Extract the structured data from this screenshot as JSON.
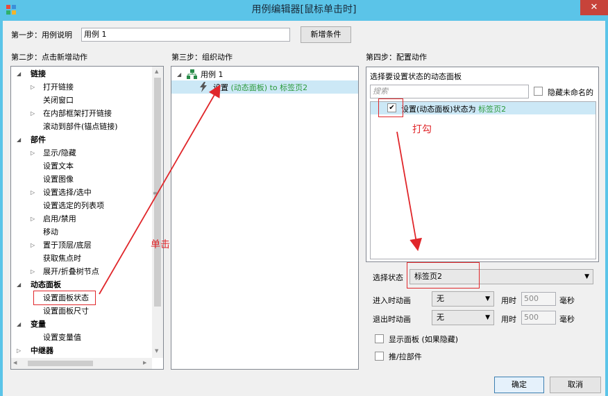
{
  "window": {
    "title": "用例编辑器[鼠标单击时]",
    "close_glyph": "✕"
  },
  "step1": {
    "label": "第一步：用例说明",
    "case_name": "用例 1",
    "add_condition_button": "新增条件"
  },
  "step2": {
    "label": "第二步：点击新增动作",
    "tree": [
      {
        "text": "链接",
        "bold": true,
        "expand": "◢"
      },
      {
        "text": "打开链接",
        "expand": "▷"
      },
      {
        "text": "关闭窗口"
      },
      {
        "text": "在内部框架打开链接",
        "expand": "▷"
      },
      {
        "text": "滚动到部件(锚点链接)"
      },
      {
        "text": "部件",
        "bold": true,
        "expand": "◢"
      },
      {
        "text": "显示/隐藏",
        "expand": "▷"
      },
      {
        "text": "设置文本"
      },
      {
        "text": "设置图像"
      },
      {
        "text": "设置选择/选中",
        "expand": "▷"
      },
      {
        "text": "设置选定的列表项"
      },
      {
        "text": "启用/禁用",
        "expand": "▷"
      },
      {
        "text": "移动"
      },
      {
        "text": "置于顶层/底层",
        "expand": "▷"
      },
      {
        "text": "获取焦点时"
      },
      {
        "text": "展开/折叠树节点",
        "expand": "▷"
      },
      {
        "text": "动态面板",
        "bold": true,
        "expand": "◢"
      },
      {
        "text": "设置面板状态",
        "highlight": true
      },
      {
        "text": "设置面板尺寸"
      },
      {
        "text": "变量",
        "bold": true,
        "expand": "◢"
      },
      {
        "text": "设置变量值"
      },
      {
        "text": "中继器",
        "bold": true,
        "expand": "▷"
      }
    ]
  },
  "step3": {
    "label": "第三步：组织动作",
    "case_label": "用例 1",
    "action_prefix": "设置",
    "action_detail": "(动态面板) to 标签页2"
  },
  "step4": {
    "label": "第四步：配置动作",
    "panel_heading": "选择要设置状态的动态面板",
    "search_placeholder": "搜索",
    "hide_unnamed": "隐藏未命名的",
    "item_prefix": "设置(动态面板)状态为",
    "item_value": "标签页2",
    "select_state_label": "选择状态",
    "select_state_value": "标签页2",
    "enter_anim_label": "进入时动画",
    "enter_anim_value": "无",
    "exit_anim_label": "退出时动画",
    "exit_anim_value": "无",
    "time_label": "用时",
    "time_value": "500",
    "ms_label": "毫秒",
    "show_panel": "显示面板 (如果隐藏)",
    "push_pull": "推/拉部件"
  },
  "annotations": {
    "click": "单击",
    "check": "打勾"
  },
  "footer": {
    "ok": "确定",
    "cancel": "取消"
  },
  "colors": {
    "annotation": "#e0262a",
    "green_text": "#2b9a3a",
    "title_bar": "#5bc4e8"
  }
}
